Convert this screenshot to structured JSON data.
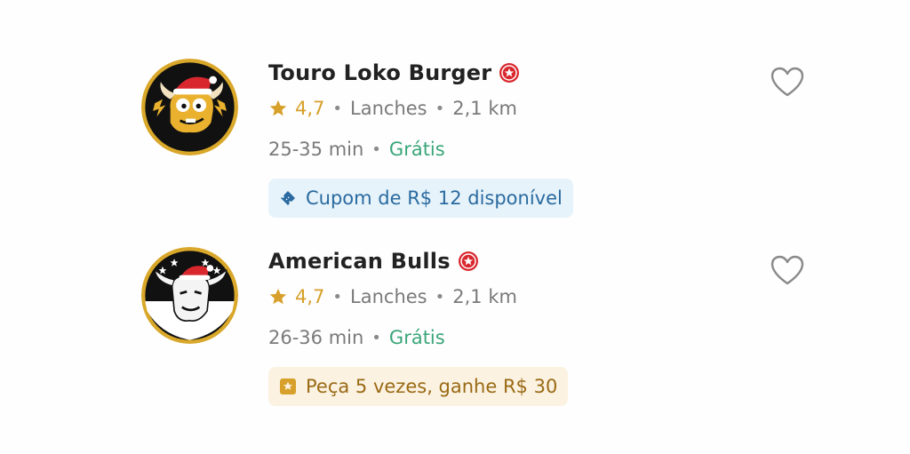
{
  "colors": {
    "name": "#222222",
    "meta": "#7a7a7a",
    "rating_star": "#d7a02a",
    "free_delivery": "#3aa679",
    "super_badge": "#d9272e",
    "coupon_bg": "#e6f3fa",
    "coupon_text": "#2a6aa0",
    "loyalty_bg": "#fbf2e2",
    "loyalty_text": "#9a6a14",
    "heart_outline": "#8a8a8a"
  },
  "restaurants": [
    {
      "name": "Touro Loko Burger",
      "logo_icon": "touro-loko-logo",
      "badge_icon": "super-restaurant-badge-icon",
      "rating": "4,7",
      "category": "Lanches",
      "distance": "2,1 km",
      "delivery_time": "25-35 min",
      "delivery_fee": "Grátis",
      "promo_icon": "ticket-icon",
      "promo_text": "Cupom de R$ 12 disponível",
      "favorite_icon": "heart-outline-icon"
    },
    {
      "name": "American Bulls",
      "logo_icon": "american-bulls-logo",
      "badge_icon": "super-restaurant-badge-icon",
      "rating": "4,7",
      "category": "Lanches",
      "distance": "2,1 km",
      "delivery_time": "26-36 min",
      "delivery_fee": "Grátis",
      "promo_icon": "loyalty-star-icon",
      "promo_text": "Peça 5 vezes, ganhe R$ 30",
      "favorite_icon": "heart-outline-icon"
    }
  ]
}
